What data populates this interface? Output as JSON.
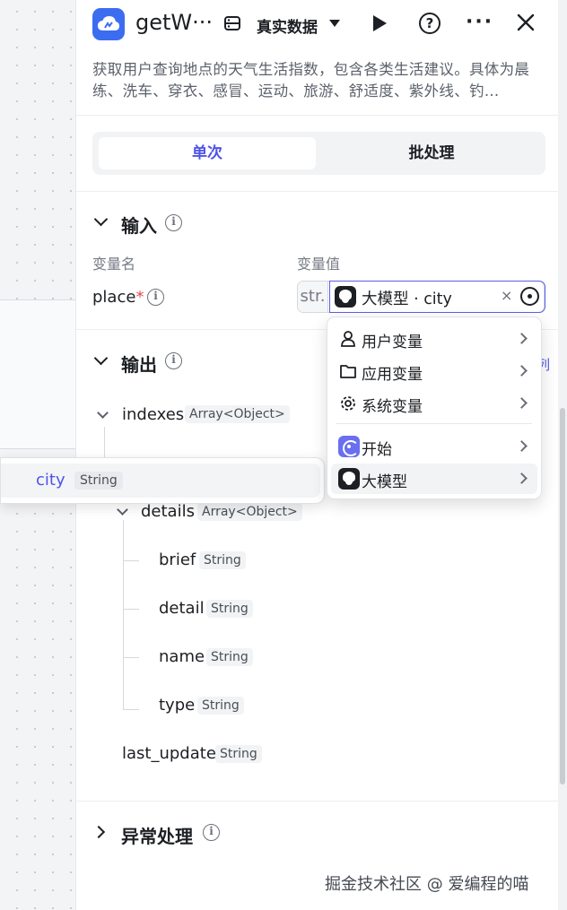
{
  "header": {
    "title": "getW···",
    "data_mode": "真实数据",
    "description": "获取用户查询地点的天气生活指数，包含各类生活建议。具体为晨练、洗车、穿衣、感冒、运动、旅游、舒适度、紫外线、钓…"
  },
  "tabs": [
    {
      "label": "单次",
      "active": true
    },
    {
      "label": "批处理",
      "active": false
    }
  ],
  "input": {
    "section_title": "输入",
    "col_name_label": "变量名",
    "col_value_label": "变量值",
    "param_name": "place",
    "required_mark": "*",
    "type_prefix": "str.",
    "value_ref": "大模型 · city",
    "clear_glyph": "×"
  },
  "menu": {
    "items": [
      {
        "label": "用户变量",
        "icon": "user-icon"
      },
      {
        "label": "应用变量",
        "icon": "folder-icon"
      },
      {
        "label": "系统变量",
        "icon": "gear-icon"
      },
      {
        "label": "开始",
        "icon": "start-node-icon"
      },
      {
        "label": "大模型",
        "icon": "llm-node-icon",
        "highlighted": true
      }
    ]
  },
  "output": {
    "section_title": "输出",
    "link_fragment": "列",
    "fields": {
      "indexes": {
        "name": "indexes",
        "type": "Array<Object>"
      },
      "details": {
        "name": "details",
        "type": "Array<Object>"
      },
      "brief": {
        "name": "brief",
        "type": "String"
      },
      "detail": {
        "name": "detail",
        "type": "String"
      },
      "name": {
        "name": "name",
        "type": "String"
      },
      "type": {
        "name": "type",
        "type": "String"
      },
      "last_update": {
        "name": "last_update",
        "type": "String"
      }
    }
  },
  "drag_item": {
    "name": "city",
    "type": "String"
  },
  "exception": {
    "section_title": "异常处理"
  },
  "watermark": "掘金技术社区 @ 爱编程的喵",
  "colors": {
    "accent": "#4d53e8",
    "brand_icon": "#3c6df0"
  }
}
